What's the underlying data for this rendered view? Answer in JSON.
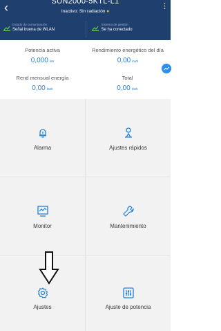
{
  "header": {
    "title": "SUN2000-5KTL-L1",
    "subtitle_status": "Inactivo: Sin radiación",
    "status_dot": "●",
    "back_icon": "‹",
    "menu_icon": "⋮"
  },
  "status_bar": {
    "communication_label": "Estado de comunicación",
    "communication_value": "Señal buena de WLAN",
    "management_label": "Sistema de gestión",
    "management_value": "Se ha conectado"
  },
  "stats": {
    "active_power_label": "Potencia activa",
    "active_power_value": "0,000",
    "active_power_unit": "kW",
    "daily_yield_label": "Rendimiento energético del día",
    "daily_yield_value": "0,00",
    "daily_yield_unit": "kWh",
    "monthly_label": "Rend mensual energía",
    "monthly_value": "0,00",
    "monthly_unit": "kWh",
    "total_label": "Total",
    "total_value": "0,00",
    "total_unit": "kWh"
  },
  "menu": {
    "alarm": "Alarma",
    "quick_settings": "Ajustes rápidos",
    "monitor": "Monitor",
    "maintenance": "Mantenimiento",
    "settings": "Ajustes",
    "power_adjust": "Ajuste de potencia"
  },
  "colors": {
    "header_bg": "#1f3f6e",
    "accent": "#1f7fd7",
    "status_green": "#5bc94b",
    "dot_yellow": "#f6c33b"
  }
}
